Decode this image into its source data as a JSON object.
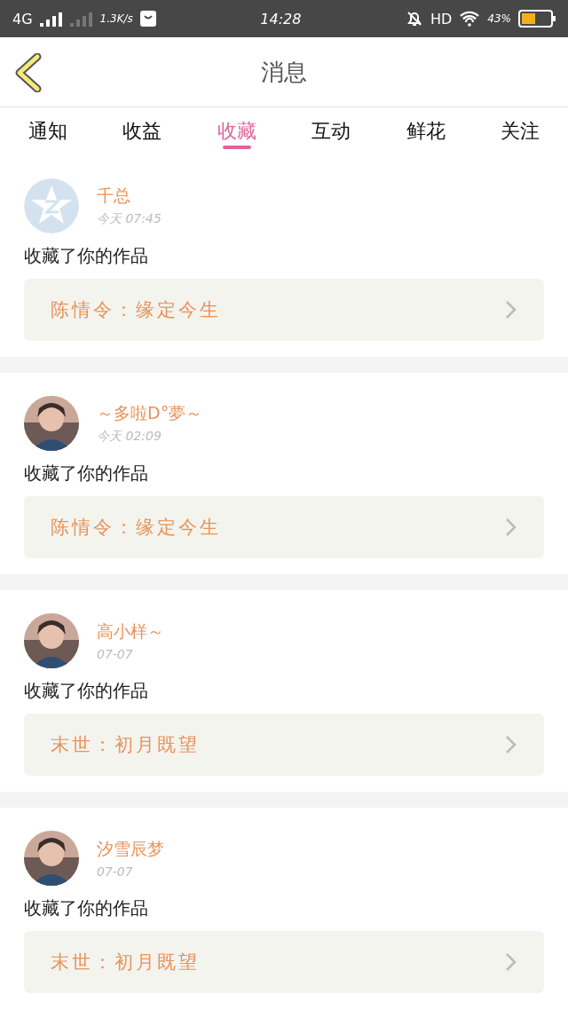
{
  "status_bar": {
    "network": "4G",
    "speed": "1.3K/s",
    "time": "14:28",
    "hd": "HD",
    "battery": "43%"
  },
  "header": {
    "title": "消息"
  },
  "tabs": [
    {
      "label": "通知",
      "selected": false
    },
    {
      "label": "收益",
      "selected": false
    },
    {
      "label": "收藏",
      "selected": true
    },
    {
      "label": "互动",
      "selected": false
    },
    {
      "label": "鲜花",
      "selected": false
    },
    {
      "label": "关注",
      "selected": false
    }
  ],
  "messages": [
    {
      "name": "千总",
      "time": "今天 07:45",
      "action": "收藏了你的作品",
      "work": "陈情令：缘定今生",
      "avatar": {
        "kind": "icon"
      }
    },
    {
      "name": "～多啦D°夢～",
      "time": "今天 02:09",
      "action": "收藏了你的作品",
      "work": "陈情令：缘定今生"
    },
    {
      "name": "高小样～",
      "time": "07-07",
      "action": "收藏了你的作品",
      "work": "末世：初月既望"
    },
    {
      "name": "汐雪辰梦",
      "time": "07-07",
      "action": "收藏了你的作品",
      "work": "末世：初月既望"
    }
  ]
}
